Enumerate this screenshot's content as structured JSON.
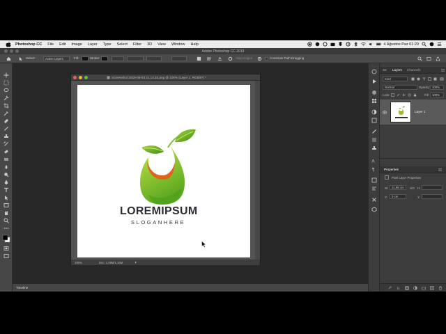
{
  "menubar": {
    "app": "Photoshop CC",
    "items": [
      "File",
      "Edit",
      "Image",
      "Layer",
      "Type",
      "Select",
      "Filter",
      "3D",
      "View",
      "Window",
      "Help"
    ],
    "clock": "4 Ağustos Paz  01:29"
  },
  "app_title": "Adobe Photoshop CC 2019",
  "options": {
    "select_label": "Select:",
    "select_value": "Active Layers",
    "fill_label": "Fill:",
    "stroke_label": "Stroke:",
    "align_edges": "Align Edges",
    "constrain": "Constrain Path Dragging"
  },
  "document": {
    "title": "Screenshot 2019-08-03 21.14.33.png @ 100% (Layer 1, RGB/8*) *",
    "zoom": "100%",
    "doc_info": "Doc: 1,09M/1,16M",
    "logo_title": "LOREMIPSUM",
    "logo_slogan": "SLOGANHERE"
  },
  "timeline": {
    "label": "Timeline"
  },
  "layers_panel": {
    "tabs": [
      "3D",
      "Layers",
      "Channels"
    ],
    "active_tab": "Layers",
    "kind_label": "Kind",
    "blend_mode": "Normal",
    "opacity_label": "Opacity:",
    "opacity_value": "100%",
    "lock_label": "Lock:",
    "fill_label": "Fill:",
    "fill_value": "100%",
    "layer_name": "Layer 1"
  },
  "properties_panel": {
    "title": "Properties",
    "subtitle": "Pixel Layer Properties",
    "w_label": "W:",
    "w_value": "21,96 cm",
    "go_label": "GO",
    "h_label": "H:",
    "x_label": "X:",
    "x_value": "0 cm",
    "y_label": "Y:"
  },
  "colors": {
    "leaf_light": "#b5d93a",
    "leaf_dark": "#4f9f1e",
    "swoosh": "#e0641a",
    "text": "#2d2d35"
  }
}
